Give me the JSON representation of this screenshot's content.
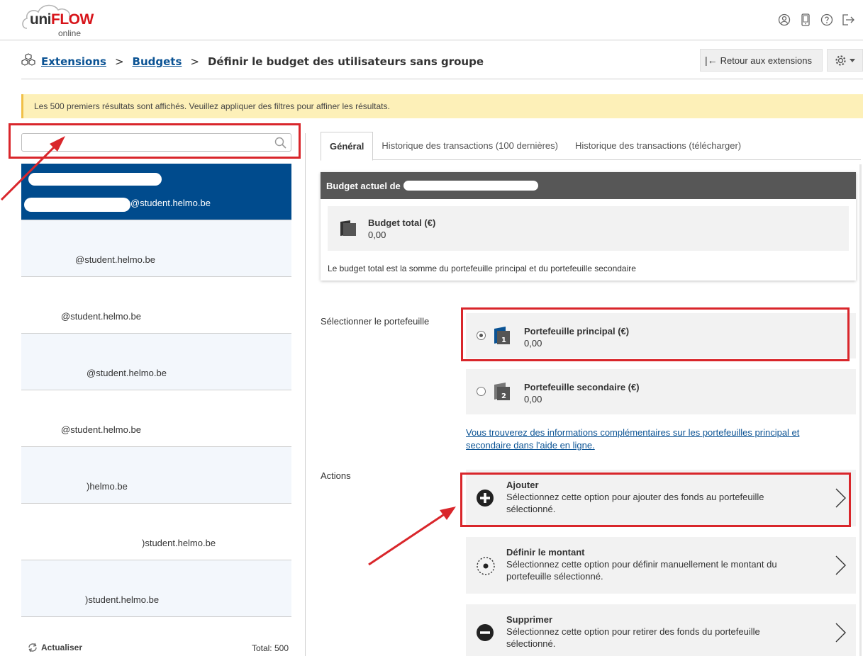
{
  "logo": {
    "brand_a": "uni",
    "brand_b": "FLOW",
    "sub": "online"
  },
  "breadcrumb": {
    "items": [
      "Extensions",
      "Budgets"
    ],
    "separator": ">",
    "current": "Définir le budget des utilisateurs sans groupe"
  },
  "toolbar": {
    "back_label": "Retour aux extensions"
  },
  "notice": "Les 500 premiers résultats sont affichés. Veuillez appliquer des filtres pour affiner les résultats.",
  "search": {
    "value": "",
    "placeholder": ""
  },
  "users": [
    {
      "email": "@student.helmo.be"
    },
    {
      "email": "@student.helmo.be"
    },
    {
      "email": "@student.helmo.be"
    },
    {
      "email": "@student.helmo.be"
    },
    {
      "email": "@student.helmo.be"
    },
    {
      "email": ")helmo.be"
    },
    {
      "email": ")student.helmo.be"
    },
    {
      "email": ")student.helmo.be"
    }
  ],
  "list_footer": {
    "refresh_label": "Actualiser",
    "total_label": "Total: 500"
  },
  "tabs": [
    "Général",
    "Historique des transactions (100 dernières)",
    "Historique des transactions (télécharger)"
  ],
  "budget": {
    "header": "Budget actuel de",
    "total_title": "Budget total (€)",
    "total_value": "0,00",
    "note": "Le budget total est la somme du portefeuille principal et du portefeuille secondaire"
  },
  "wallets": {
    "label": "Sélectionner le portefeuille",
    "primary": {
      "title": "Portefeuille principal (€)",
      "value": "0,00",
      "badge": "1"
    },
    "secondary": {
      "title": "Portefeuille secondaire (€)",
      "value": "0,00",
      "badge": "2"
    },
    "help_link": "Vous trouverez des informations complémentaires sur les portefeuilles principal et secondaire dans l'aide en ligne."
  },
  "actions": {
    "label": "Actions",
    "items": [
      {
        "title": "Ajouter",
        "desc": "Sélectionnez cette option pour ajouter des fonds au portefeuille sélectionné."
      },
      {
        "title": "Définir le montant",
        "desc": "Sélectionnez cette option pour définir manuellement le montant du portefeuille sélectionné."
      },
      {
        "title": "Supprimer",
        "desc": "Sélectionnez cette option pour retirer des fonds du portefeuille sélectionné."
      }
    ]
  },
  "colors": {
    "selected_row": "#004b8d",
    "link": "#0b5394",
    "brand_red": "#d7141a",
    "annotation_red": "#d9262b",
    "notice_bg": "#fdf0b8"
  }
}
